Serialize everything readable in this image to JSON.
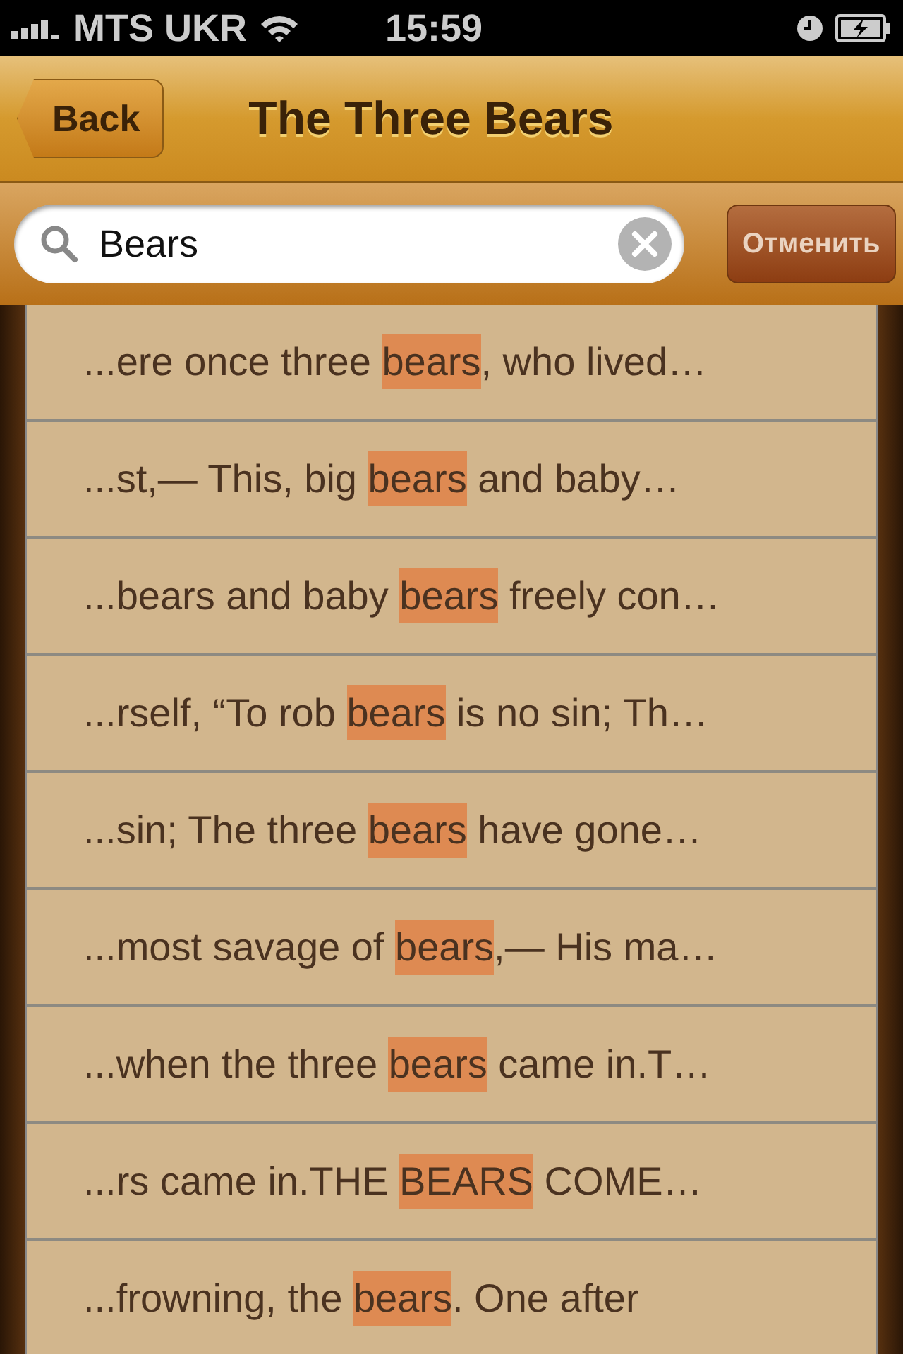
{
  "status_bar": {
    "carrier": "MTS UKR",
    "time": "15:59"
  },
  "nav": {
    "back": "Back",
    "title": "The Three Bears"
  },
  "search": {
    "value": "Bears",
    "cancel": "Отменить"
  },
  "results": [
    {
      "before": "...ere once three ",
      "match": "bears",
      "after": ", who lived…"
    },
    {
      "before": "...st,— This, big ",
      "match": "bears",
      "after": " and baby…"
    },
    {
      "before": "...bears and baby ",
      "match": "bears",
      "after": " freely con…"
    },
    {
      "before": "...rself, “To rob ",
      "match": "bears",
      "after": " is no sin; Th…"
    },
    {
      "before": "...sin; The three ",
      "match": "bears",
      "after": " have gone…"
    },
    {
      "before": "...most savage of ",
      "match": "bears",
      "after": ",— His ma…"
    },
    {
      "before": "...when the three ",
      "match": "bears",
      "after": " came in.T…"
    },
    {
      "before": "...rs came in.THE ",
      "match": "BEARS",
      "after": " COME…"
    },
    {
      "before": "...frowning, the ",
      "match": "bears",
      "after": ". One after"
    }
  ]
}
